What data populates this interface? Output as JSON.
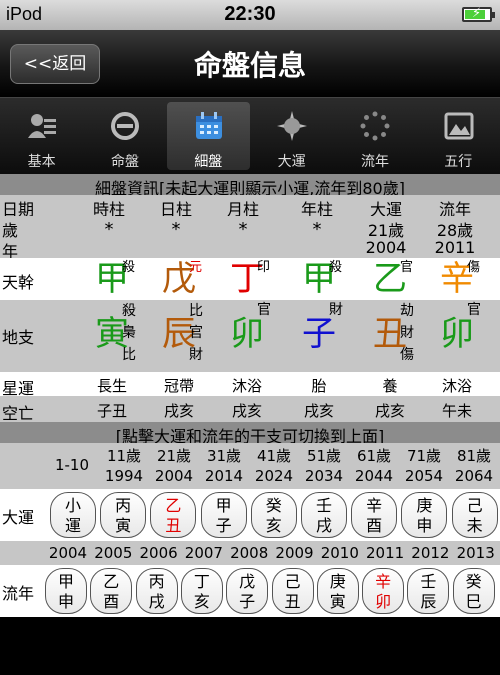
{
  "status_bar": {
    "carrier": "iPod",
    "time": "22:30",
    "battery_level": 0.85
  },
  "nav": {
    "back_label": "<<返回",
    "title": "命盤信息"
  },
  "tabs": [
    {
      "label": "基本",
      "icon": "person-card-icon",
      "active": false
    },
    {
      "label": "命盤",
      "icon": "forbidden-circle-icon",
      "active": false
    },
    {
      "label": "細盤",
      "icon": "calendar-icon",
      "active": true
    },
    {
      "label": "大運",
      "icon": "compass-star-icon",
      "active": false
    },
    {
      "label": "流年",
      "icon": "loading-ring-icon",
      "active": false
    },
    {
      "label": "五行",
      "icon": "picture-icon",
      "active": false
    }
  ],
  "banner1": "細盤資訊[未起大運則顯示小運,流年到80歲]",
  "header": {
    "labels": [
      "日期",
      "時柱",
      "日柱",
      "月柱",
      "年柱",
      "大運",
      "流年"
    ],
    "age_label_1": "歲",
    "age_label_2": "年",
    "stars": [
      "*",
      "*",
      "*",
      "*"
    ],
    "dayun": {
      "age": "21歲",
      "year": "2004"
    },
    "liunian": {
      "age": "28歲",
      "year": "2011"
    }
  },
  "tiangan": {
    "label": "天幹",
    "items": [
      {
        "char": "甲",
        "color": "#1a9a1a",
        "note": "殺",
        "note_color": "#000"
      },
      {
        "char": "戊",
        "color": "#b35a0a",
        "note": "元",
        "note_color": "#e00000"
      },
      {
        "char": "丁",
        "color": "#e00000",
        "note": "印",
        "note_color": "#000"
      },
      {
        "char": "甲",
        "color": "#1a9a1a",
        "note": "殺",
        "note_color": "#000"
      },
      {
        "char": "乙",
        "color": "#1a9a1a",
        "note": "官",
        "note_color": "#000"
      },
      {
        "char": "辛",
        "color": "#f08a00",
        "note": "傷",
        "note_color": "#000"
      }
    ]
  },
  "dizhi": {
    "label": "地支",
    "items": [
      {
        "char": "寅",
        "color": "#1a9a1a",
        "notes": [
          "殺",
          "梟",
          "比"
        ]
      },
      {
        "char": "辰",
        "color": "#b35a0a",
        "notes": [
          "比",
          "官",
          "財"
        ]
      },
      {
        "char": "卯",
        "color": "#1a9a1a",
        "notes": [
          "官"
        ]
      },
      {
        "char": "子",
        "color": "#1010d0",
        "notes": [
          "財"
        ]
      },
      {
        "char": "丑",
        "color": "#b35a0a",
        "notes": [
          "劫",
          "財",
          "傷"
        ]
      },
      {
        "char": "卯",
        "color": "#1a9a1a",
        "notes": [
          "官"
        ]
      }
    ]
  },
  "xingyun": {
    "label": "星運",
    "values": [
      "長生",
      "冠帶",
      "沐浴",
      "胎",
      "養",
      "沐浴"
    ]
  },
  "kongwang": {
    "label": "空亡",
    "values": [
      "子丑",
      "戌亥",
      "戌亥",
      "戌亥",
      "戌亥",
      "午未"
    ]
  },
  "banner2": "[點擊大運和流年的干支可切換到上面]",
  "dayun_ages": [
    "1-10",
    "11歲",
    "21歲",
    "31歲",
    "41歲",
    "51歲",
    "61歲",
    "71歲",
    "81歲"
  ],
  "dayun_years": [
    "",
    "1994",
    "2004",
    "2014",
    "2024",
    "2034",
    "2044",
    "2054",
    "2064"
  ],
  "dayun_row": {
    "label": "大運",
    "pills": [
      {
        "top": "小",
        "bottom": "運",
        "color": "#000"
      },
      {
        "top": "丙",
        "bottom": "寅",
        "color": "#000"
      },
      {
        "top": "乙",
        "bottom": "丑",
        "color": "#e00000"
      },
      {
        "top": "甲",
        "bottom": "子",
        "color": "#000"
      },
      {
        "top": "癸",
        "bottom": "亥",
        "color": "#000"
      },
      {
        "top": "壬",
        "bottom": "戌",
        "color": "#000"
      },
      {
        "top": "辛",
        "bottom": "酉",
        "color": "#000"
      },
      {
        "top": "庚",
        "bottom": "申",
        "color": "#000"
      },
      {
        "top": "己",
        "bottom": "未",
        "color": "#000"
      }
    ]
  },
  "liunian_years": [
    "2004",
    "2005",
    "2006",
    "2007",
    "2008",
    "2009",
    "2010",
    "2011",
    "2012",
    "2013"
  ],
  "liunian_row": {
    "label": "流年",
    "pills": [
      {
        "top": "甲",
        "bottom": "申",
        "color": "#000"
      },
      {
        "top": "乙",
        "bottom": "酉",
        "color": "#000"
      },
      {
        "top": "丙",
        "bottom": "戌",
        "color": "#000"
      },
      {
        "top": "丁",
        "bottom": "亥",
        "color": "#000"
      },
      {
        "top": "戊",
        "bottom": "子",
        "color": "#000"
      },
      {
        "top": "己",
        "bottom": "丑",
        "color": "#000"
      },
      {
        "top": "庚",
        "bottom": "寅",
        "color": "#000"
      },
      {
        "top": "辛",
        "bottom": "卯",
        "color": "#e00000"
      },
      {
        "top": "壬",
        "bottom": "辰",
        "color": "#000"
      },
      {
        "top": "癸",
        "bottom": "巳",
        "color": "#000"
      }
    ]
  }
}
